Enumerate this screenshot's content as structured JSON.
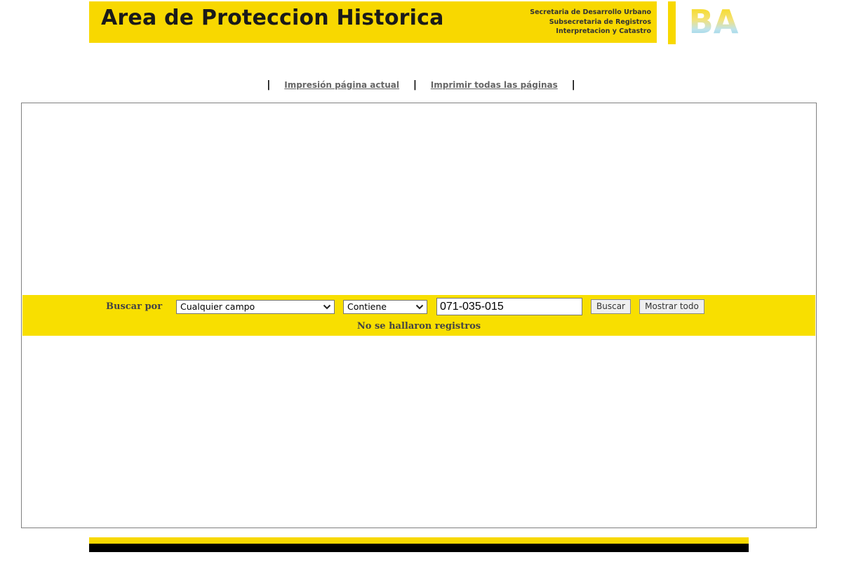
{
  "header": {
    "title": "Area de Proteccion Historica",
    "dept_lines": [
      "Secretaria de Desarrollo Urbano",
      "Subsecretaria de Registros",
      "Interpretacion y Catastro"
    ],
    "logo_text": "BA",
    "brand_color": "#f8d800"
  },
  "print_links": {
    "current_page": "Impresión página actual",
    "all_pages": "Imprimir todas las páginas",
    "separator": "|"
  },
  "search": {
    "label": "Buscar por",
    "field_selected": "Cualquier campo",
    "operator_selected": "Contiene",
    "query_value": "071-035-015",
    "search_button": "Buscar",
    "show_all_button": "Mostrar todo",
    "result_message": "No se hallaron registros",
    "band_color": "#f8df00"
  },
  "icons": {
    "select_arrow": "chevron-down-icon"
  }
}
